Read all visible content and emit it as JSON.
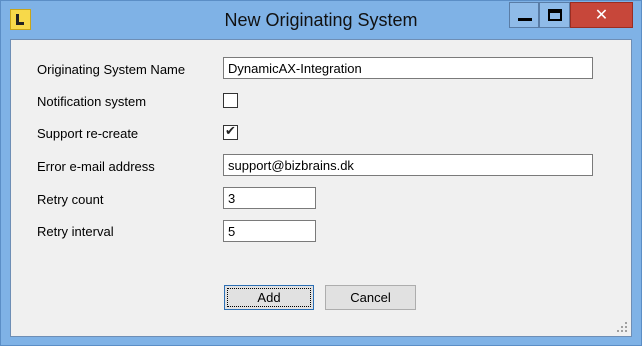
{
  "window": {
    "title": "New Originating System",
    "icon": "app-logo-icon",
    "controls": {
      "minimize": "minimize-icon",
      "maximize": "maximize-icon",
      "close": "✕"
    }
  },
  "form": {
    "originating_system_name": {
      "label": "Originating System Name",
      "value": "DynamicAX-Integration"
    },
    "notification_system": {
      "label": "Notification system",
      "checked": false
    },
    "support_recreate": {
      "label": "Support re-create",
      "checked": true,
      "mark": "✔"
    },
    "error_email": {
      "label": "Error e-mail address",
      "value": "support@bizbrains.dk"
    },
    "retry_count": {
      "label": "Retry count",
      "value": "3"
    },
    "retry_interval": {
      "label": "Retry interval",
      "value": "5"
    }
  },
  "buttons": {
    "add": "Add",
    "cancel": "Cancel"
  },
  "colors": {
    "titlebar": "#7fb2e6",
    "close_button": "#c7473a",
    "client": "#f0f0f0"
  }
}
